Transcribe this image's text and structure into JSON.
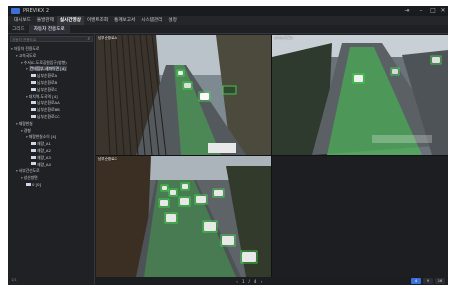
{
  "window": {
    "title": "PREVIKX 2"
  },
  "menu": [
    {
      "label": "대시보드",
      "active": false
    },
    {
      "label": "돌발관제",
      "active": false
    },
    {
      "label": "실시간영상",
      "active": true
    },
    {
      "label": "이벤트조회",
      "active": false
    },
    {
      "label": "통계보고서",
      "active": false
    },
    {
      "label": "시스템관리",
      "active": false
    },
    {
      "label": "설정",
      "active": false
    }
  ],
  "tabs": [
    {
      "label": "그리드",
      "active": false
    },
    {
      "label": "자동차 전용도로",
      "active": true
    }
  ],
  "sidebar": {
    "search_placeholder": "자동차 전용도로",
    "tree": [
      {
        "label": "자동차 전용도로",
        "depth": 0,
        "type": "folder"
      },
      {
        "label": "고속국도로",
        "depth": 1,
        "type": "folder"
      },
      {
        "label": "수서IC-도로공원입구(방향)",
        "depth": 2,
        "type": "folder"
      },
      {
        "label": "컨테움부-세파이면 [4]",
        "depth": 3,
        "type": "folder",
        "selected": true
      },
      {
        "label": "남부순환로A",
        "depth": 4,
        "type": "camera"
      },
      {
        "label": "남부순환로B",
        "depth": 4,
        "type": "camera"
      },
      {
        "label": "남부순환로C",
        "depth": 4,
        "type": "camera"
      },
      {
        "label": "대치역-도곡역 [4]",
        "depth": 3,
        "type": "folder"
      },
      {
        "label": "남부순환로AA",
        "depth": 4,
        "type": "camera"
      },
      {
        "label": "남부순환로BB",
        "depth": 4,
        "type": "camera"
      },
      {
        "label": "남부순환로CC",
        "depth": 4,
        "type": "camera"
      },
      {
        "label": "재량한실",
        "depth": 1,
        "type": "folder"
      },
      {
        "label": "경형",
        "depth": 2,
        "type": "folder"
      },
      {
        "label": "재량한실소이 [4]",
        "depth": 3,
        "type": "folder"
      },
      {
        "label": "재량_A1",
        "depth": 4,
        "type": "camera"
      },
      {
        "label": "재량_A2",
        "depth": 4,
        "type": "camera"
      },
      {
        "label": "재량_A3",
        "depth": 4,
        "type": "camera"
      },
      {
        "label": "재량_A4",
        "depth": 4,
        "type": "camera"
      },
      {
        "label": "서부간선도로",
        "depth": 1,
        "type": "folder"
      },
      {
        "label": "성산방면",
        "depth": 2,
        "type": "folder"
      },
      {
        "label": "0 [0]",
        "depth": 3,
        "type": "camera"
      }
    ],
    "footer": "1/1"
  },
  "tiles": [
    {
      "label": "남부순환로A",
      "scene": "A"
    },
    {
      "label": "남부순환로B",
      "scene": "B"
    },
    {
      "label": "남부순환로C",
      "scene": "C"
    },
    {
      "label": "",
      "scene": "empty"
    }
  ],
  "pager": {
    "prev": "‹",
    "current": "1",
    "sep": "/",
    "total": "4",
    "next": "›"
  },
  "layouts": [
    {
      "label": "4",
      "active": true
    },
    {
      "label": "9",
      "active": false
    },
    {
      "label": "16",
      "active": false
    }
  ],
  "colors": {
    "accent": "#3d6fd9",
    "detect": "#3fdc4a",
    "bg": "#1e1f23"
  }
}
